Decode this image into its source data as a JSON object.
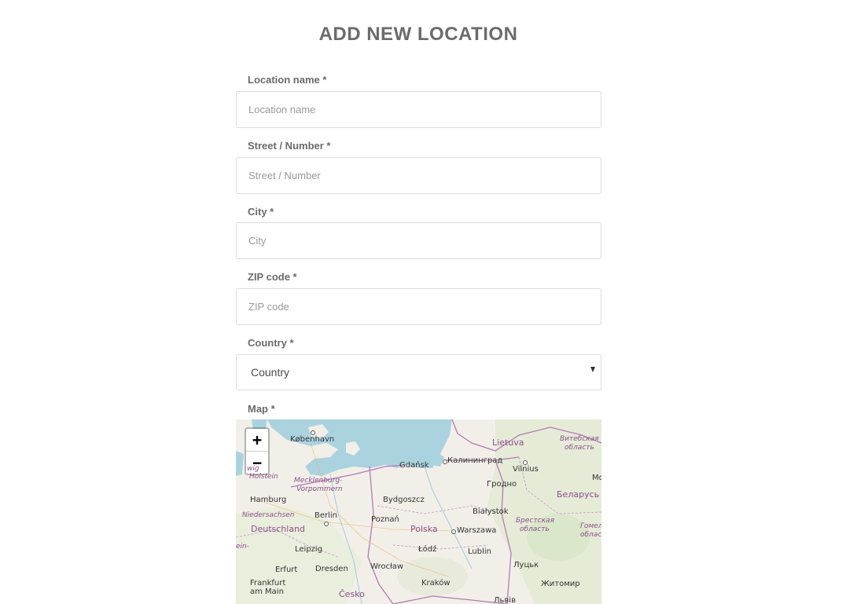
{
  "page": {
    "title": "ADD NEW LOCATION"
  },
  "form": {
    "location_name": {
      "label": "Location name *",
      "placeholder": "Location name",
      "value": ""
    },
    "street": {
      "label": "Street / Number *",
      "placeholder": "Street / Number",
      "value": ""
    },
    "city": {
      "label": "City *",
      "placeholder": "City",
      "value": ""
    },
    "zip": {
      "label": "ZIP code *",
      "placeholder": "ZIP code",
      "value": ""
    },
    "country": {
      "label": "Country *",
      "selected": "Country",
      "icon": "chevron-down-icon"
    },
    "map": {
      "label": "Map *"
    }
  },
  "map": {
    "zoom_in_label": "+",
    "zoom_out_label": "−",
    "colors": {
      "water": "#aad3df",
      "land": "#f2efe9",
      "green": "#cfe4bf",
      "border": "#b57ab5"
    },
    "labels": {
      "copenhagen": "København",
      "gdansk": "Gdańsk",
      "kaliningrad": "Калининград",
      "lietuva": "Lietuva",
      "vitebsk": "Витебская",
      "vitebsk2": "область",
      "vilnius": "Vilnius",
      "wig": "wig",
      "holstein": "Holstein",
      "mecklenburg": "Mecklenburg-",
      "vorpommern": "Vorpommern",
      "grodno": "Гродно",
      "belarus": "Беларусь",
      "hamburg": "Hamburg",
      "bydgoszcz": "Bydgoszcz",
      "niedersachsen": "Niedersachsen",
      "berlin": "Berlin",
      "poznan": "Poznań",
      "bialystok": "Białystok",
      "brest": "Брестская",
      "brest2": "область",
      "gomel": "Гомел",
      "gomel2": "облас",
      "deutschland": "Deutschland",
      "polska": "Polska",
      "warszawa": "Warszawa",
      "leipzig": "Leipzig",
      "lodz": "Łódź",
      "lublin": "Lublin",
      "erfurt": "Erfurt",
      "dresden": "Dresden",
      "wroclaw": "Wrocław",
      "lutsk": "Луцьк",
      "frankfurt": "Frankfurt",
      "frankfurt2": "am Main",
      "cesko": "Česko",
      "krakow": "Kraków",
      "zhytomyr": "Житомир",
      "lviv": "Львів",
      "mo": "Mo",
      "ein": "ein-"
    }
  }
}
